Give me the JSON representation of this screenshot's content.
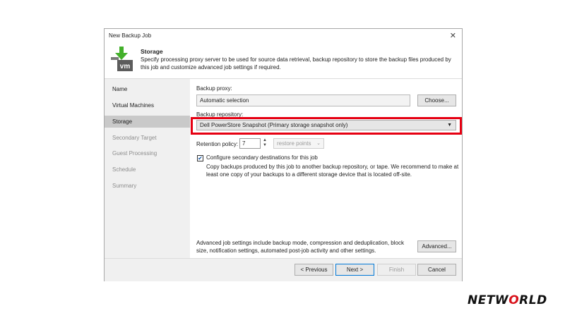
{
  "window": {
    "title": "New Backup Job",
    "close_glyph": "✕"
  },
  "header": {
    "title": "Storage",
    "description": "Specify processing proxy server to be used for source data retrieval, backup repository to store the backup files produced by this job and customize advanced job settings if required.",
    "icon": "vm-download-icon",
    "icon_text": "vm"
  },
  "sidebar": {
    "items": [
      {
        "label": "Name",
        "state": "normal"
      },
      {
        "label": "Virtual Machines",
        "state": "normal"
      },
      {
        "label": "Storage",
        "state": "active"
      },
      {
        "label": "Secondary Target",
        "state": "disabled"
      },
      {
        "label": "Guest Processing",
        "state": "disabled"
      },
      {
        "label": "Schedule",
        "state": "disabled"
      },
      {
        "label": "Summary",
        "state": "disabled"
      }
    ]
  },
  "storage": {
    "proxy_label": "Backup proxy:",
    "proxy_value": "Automatic selection",
    "choose_button": "Choose...",
    "repository_label": "Backup repository:",
    "repository_value": "Dell PowerStore Snapshot (Primary storage snapshot only)",
    "retention_label": "Retention policy:",
    "retention_value": "7",
    "retention_unit": "restore points",
    "secondary_checkbox_label": "Configure secondary destinations for this job",
    "secondary_checked": true,
    "secondary_description": "Copy backups produced by this job to another backup repository, or tape. We recommend to make at least one copy of your backups to a different storage device that is located off-site.",
    "advanced_text": "Advanced job settings include backup mode, compression and deduplication, block size, notification settings, automated post-job activity and other settings.",
    "advanced_button": "Advanced..."
  },
  "footer": {
    "previous_button": "< Previous",
    "next_button": "Next >",
    "finish_button": "Finish",
    "cancel_button": "Cancel"
  },
  "annotation": {
    "highlight_color": "#e60012"
  },
  "brand": {
    "logo_part1": "NETW",
    "logo_o": "O",
    "logo_part2": "RLD",
    "accent_color": "#d8121b"
  }
}
